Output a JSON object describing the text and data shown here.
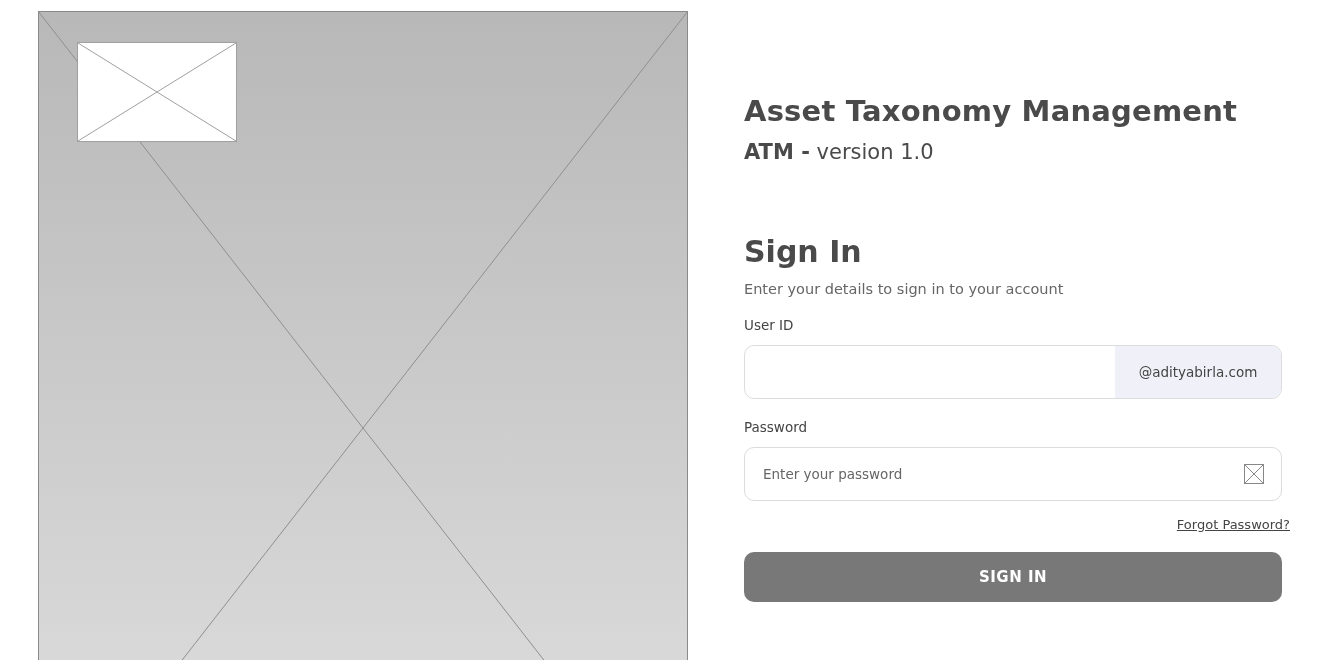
{
  "app": {
    "title": "Asset Taxonomy Management",
    "subtitle": "**ATM -** version 1.0"
  },
  "form": {
    "heading": "Sign In",
    "description": "Enter your details to sign in to your account",
    "user_id": {
      "label": "User ID",
      "suffix": "@adityabirla.com"
    },
    "password": {
      "label": "Password",
      "placeholder": "Enter your password"
    },
    "forgot_link": "Forgot Password?",
    "submit": "SIGN IN"
  }
}
